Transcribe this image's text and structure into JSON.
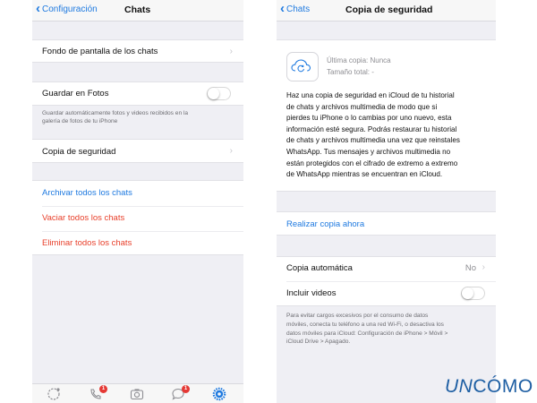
{
  "left": {
    "back_label": "Configuración",
    "title": "Chats",
    "wallpaper_label": "Fondo de pantalla de los chats",
    "save_photos_label": "Guardar en Fotos",
    "save_photos_footnote_line1": "Guardar automáticamente fotos y videos recibidos en la",
    "save_photos_footnote_line2": "galería de fotos de tu iPhone",
    "save_photos_enabled": false,
    "backup_label": "Copia de seguridad",
    "archive_all_label": "Archivar todos los chats",
    "clear_all_label": "Vaciar todos los chats",
    "delete_all_label": "Eliminar todos los chats",
    "tabs": [
      {
        "icon": "status-icon"
      },
      {
        "icon": "calls-icon",
        "badge": "1"
      },
      {
        "icon": "camera-icon"
      },
      {
        "icon": "chats-icon",
        "badge": "1"
      },
      {
        "icon": "settings-icon"
      }
    ]
  },
  "right": {
    "back_label": "Chats",
    "title": "Copia de seguridad",
    "last_backup": "Última copia: Nunca",
    "total_size": "Tamaño total: -",
    "info_lines": [
      "Haz una copia de seguridad en iCloud de tu historial",
      "de chats y archivos multimedia de modo que si",
      "pierdes tu iPhone o lo cambias por uno nuevo, esta",
      "información esté segura. Podrás restaurar tu historial",
      "de chats y archivos multimedia una vez que reinstales",
      "WhatsApp. Tus mensajes y archivos multimedia no",
      "están protegidos con el cifrado de extremo a extremo",
      "de WhatsApp mientras se encuentran en iCloud."
    ],
    "backup_now_label": "Realizar copia ahora",
    "auto_backup_label": "Copia automática",
    "auto_backup_value": "No",
    "include_videos_label": "Incluir videos",
    "include_videos_enabled": false,
    "footnote_lines": [
      "Para evitar cargos excesivos por el consumo de datos",
      "móviles, conecta tu teléfono a una red Wi-Fi, o desactiva los",
      "datos móviles para iCloud: Configuración de iPhone > Móvil >",
      "iCloud Drive > Apagado."
    ]
  },
  "watermark": {
    "part1": "UN",
    "part2": "CÓMO"
  },
  "colors": {
    "link_blue": "#1f7ae0",
    "destructive_red": "#e8412c",
    "background": "#efeff4",
    "logo_blue": "#1d5ea3",
    "badge_red": "#e53935"
  }
}
